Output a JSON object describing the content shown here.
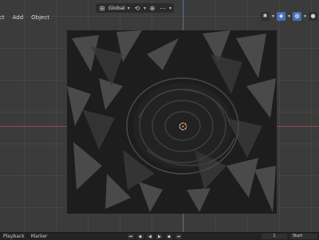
{
  "menu": {
    "items": [
      {
        "label": "ct"
      },
      {
        "label": "Add"
      },
      {
        "label": "Object"
      }
    ]
  },
  "header": {
    "orientation_label": "Global",
    "tool_icons": [
      "transform-orientation-icon",
      "pivot-icon",
      "snap-icon",
      "proportional-edit-icon"
    ]
  },
  "right_tools": {
    "icons": [
      "visibility-icon",
      "gizmo-icon",
      "overlay-icon",
      "xray-icon",
      "shading-solid-icon"
    ]
  },
  "timeline": {
    "left_labels": [
      "Playback",
      "Marker"
    ],
    "frame_value": "1",
    "start_label": "Start"
  },
  "colors": {
    "viewport_bg": "#3b3b3b",
    "x_axis": "#a84a4e",
    "y_axis": "#5b7fa8",
    "accent_active": "#4772b3",
    "mesh_dark": "#1f1f1f"
  }
}
